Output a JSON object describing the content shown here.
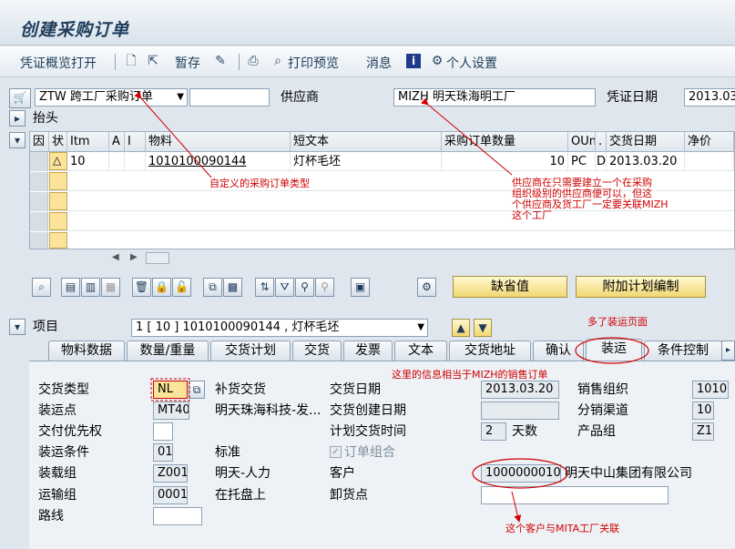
{
  "window": {
    "title": "创建采购订单"
  },
  "toolbar": {
    "doc_overview": "凭证概览打开",
    "hold": "暂存",
    "print_preview": "打印预览",
    "messages": "消息",
    "personal_settings": "个人设置"
  },
  "header": {
    "doc_type": "ZTW 跨工厂采购订单",
    "vendor_label": "供应商",
    "vendor_value": "MIZH 明天珠海明工厂",
    "doc_date_label": "凭证日期",
    "doc_date_value": "2013.03",
    "header_section": "抬头"
  },
  "table": {
    "columns": [
      "因",
      "状",
      "Itm",
      "A",
      "I",
      "物料",
      "短文本",
      "采购订单数量",
      "OUn",
      ".",
      "交货日期",
      "净价"
    ],
    "rows": [
      {
        "item": "10",
        "material": "1010100090144",
        "short_text": "灯杯毛坯",
        "qty": "10",
        "unit": "PC",
        "cat": "D",
        "delivery_date": "2013.03.20"
      }
    ]
  },
  "buttons": {
    "default_values": "缺省值",
    "additional_planning": "附加计划编制"
  },
  "item": {
    "label": "项目",
    "selector": "1 [ 10 ] 1010100090144 , 灯杯毛坯"
  },
  "tabs": [
    "物料数据",
    "数量/重量",
    "交货计划",
    "交货",
    "发票",
    "文本",
    "交货地址",
    "确认",
    "装运",
    "条件控制"
  ],
  "shipping": {
    "delivery_type_label": "交货类型",
    "delivery_type_value": "NL",
    "shipping_point_label": "装运点",
    "shipping_point_value": "MT40",
    "shipping_point_desc": "明天珠海科技-发...",
    "priority_label": "交付优先权",
    "priority_value": "",
    "shipping_cond_label": "装运条件",
    "shipping_cond_value": "01",
    "shipping_cond_desc": "标准",
    "loading_group_label": "装载组",
    "loading_group_value": "Z001",
    "loading_group_desc": "明天-人力",
    "transport_group_label": "运输组",
    "transport_group_value": "0001",
    "transport_group_desc": "在托盘上",
    "route_label": "路线",
    "route_value": "",
    "partial_delivery_label": "补货交货",
    "delivery_date_label": "交货日期",
    "delivery_date_value": "2013.03.20",
    "delivery_created_label": "交货创建日期",
    "delivery_created_value": "",
    "planned_time_label": "计划交货时间",
    "planned_time_value": "2",
    "planned_time_unit": "天数",
    "order_combination_label": "订单组合",
    "customer_label": "客户",
    "customer_value": "1000000010",
    "customer_desc": "明天中山集团有限公司",
    "unloading_point_label": "卸货点",
    "unloading_point_value": "",
    "sales_org_label": "销售组织",
    "sales_org_value": "1010",
    "dist_channel_label": "分销渠道",
    "dist_channel_value": "10",
    "division_label": "产品组",
    "division_value": "Z1"
  },
  "annotations": {
    "custom_type": "自定义的采购订单类型",
    "vendor_note_1": "供应商在只需要建立一个在采购",
    "vendor_note_2": "组织级别的供应商便可以，但这",
    "vendor_note_3": "个供应商及货工厂一定要关联MIZH",
    "vendor_note_4": "这个工厂",
    "extra_tab": "多了装运页面",
    "sales_order_note": "这里的信息相当于MIZH的销售订单",
    "customer_note": "这个客户与MITA工厂关联"
  },
  "colors": {
    "annotation": "#d00000",
    "button_yellow": "#f1d774",
    "title": "#1e3c5a"
  }
}
